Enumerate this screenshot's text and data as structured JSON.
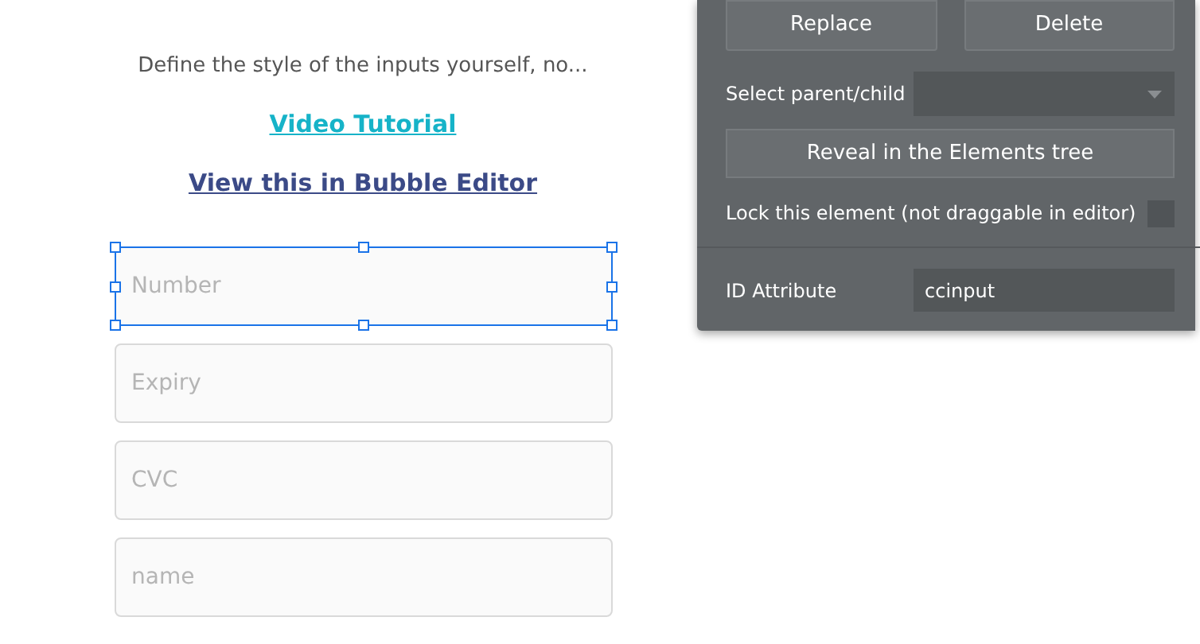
{
  "canvas": {
    "description": "Define the style of the inputs yourself, no...",
    "links": [
      {
        "kind": "tutorial",
        "label": "Video Tutorial"
      },
      {
        "kind": "editor",
        "label": "View this in Bubble Editor"
      }
    ],
    "inputs": [
      {
        "placeholder": "Number",
        "selected": true
      },
      {
        "placeholder": "Expiry",
        "selected": false
      },
      {
        "placeholder": "CVC",
        "selected": false
      },
      {
        "placeholder": "name",
        "selected": false
      }
    ]
  },
  "property_panel": {
    "buttons": [
      "Replace",
      "Delete"
    ],
    "parent_select": {
      "label": "Select parent/child"
    },
    "reveal_button": "Reveal in the Elements tree",
    "lock": {
      "label": "Lock this element (not draggable in editor)",
      "checked": false
    },
    "id_attribute": {
      "label": "ID Attribute",
      "value": "ccinput"
    }
  }
}
